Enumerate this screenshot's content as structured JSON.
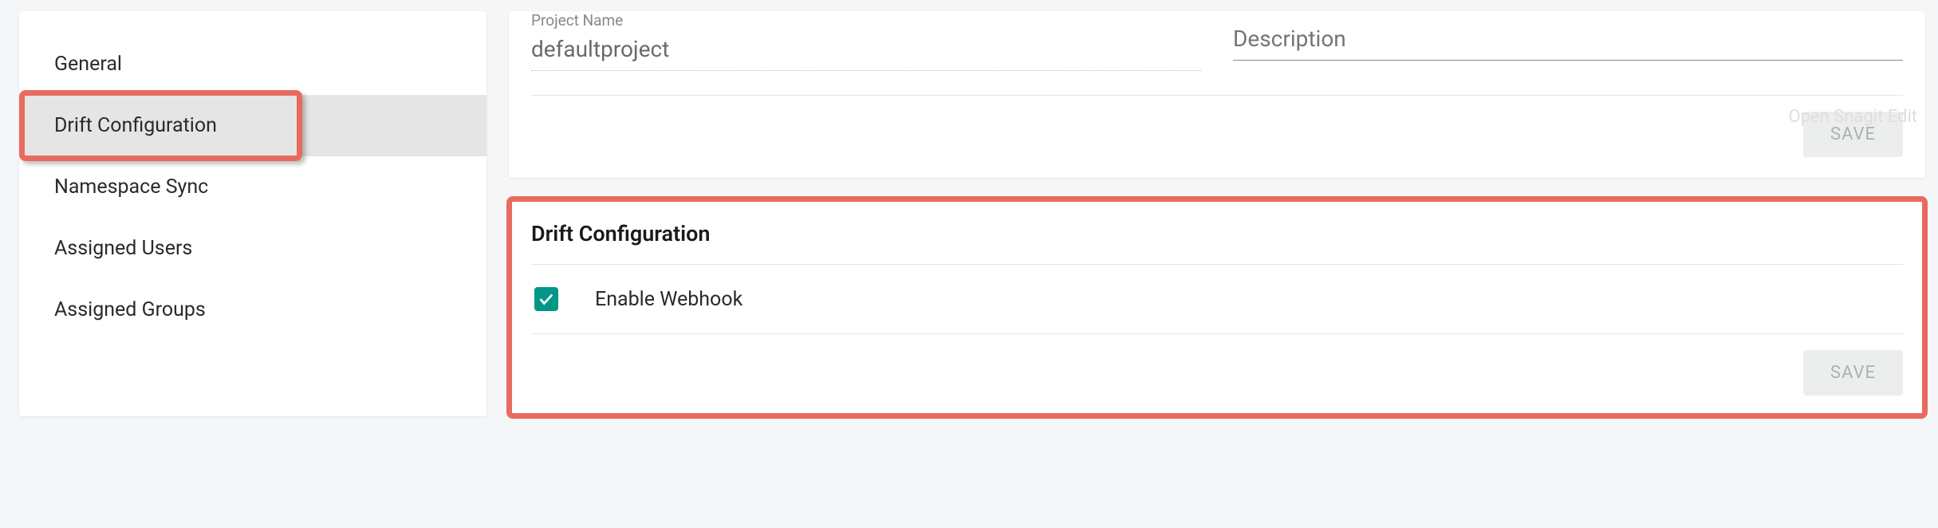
{
  "sidebar": {
    "items": [
      {
        "label": "General",
        "active": false
      },
      {
        "label": "Drift Configuration",
        "active": true
      },
      {
        "label": "Namespace Sync",
        "active": false
      },
      {
        "label": "Assigned Users",
        "active": false
      },
      {
        "label": "Assigned Groups",
        "active": false
      }
    ]
  },
  "project_form": {
    "name_label": "Project Name",
    "name_value": "defaultproject",
    "description_placeholder": "Description",
    "description_value": "",
    "save_label": "SAVE"
  },
  "drift": {
    "title": "Drift Configuration",
    "enable_webhook_label": "Enable Webhook",
    "enable_webhook_checked": true,
    "save_label": "SAVE"
  },
  "watermark": "Open Snagit Edit"
}
